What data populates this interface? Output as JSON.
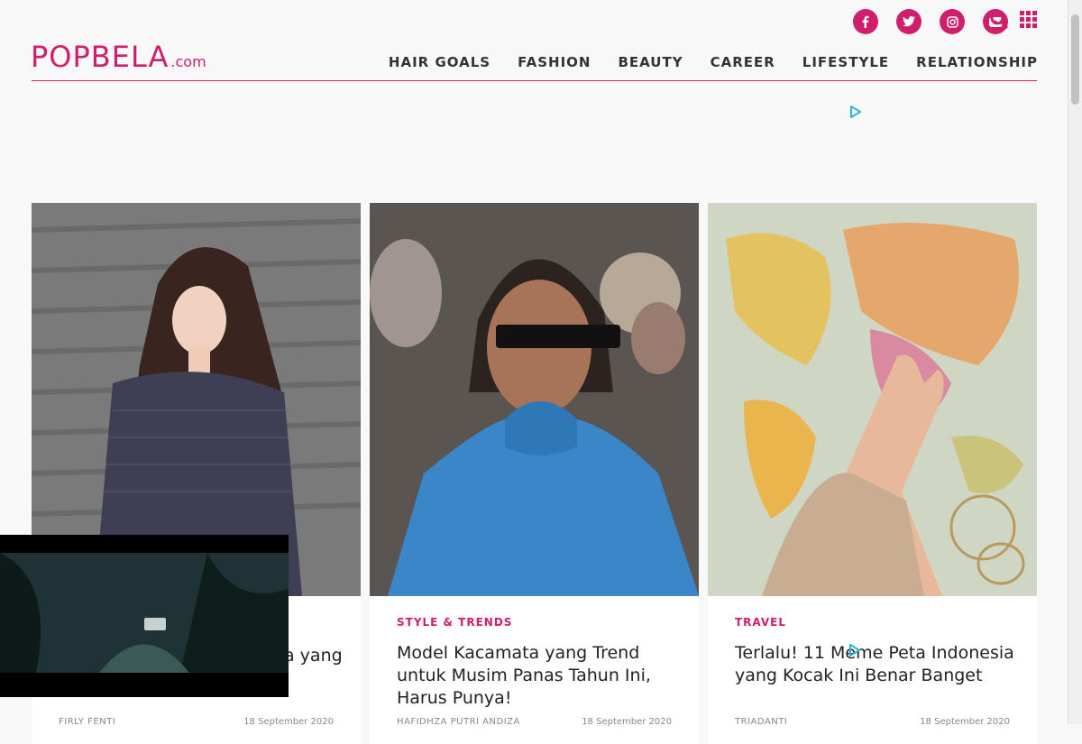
{
  "logo": {
    "main": "POPBELA",
    "suffix": ".com"
  },
  "social": [
    "f",
    "t",
    "ig",
    "yt"
  ],
  "nav": [
    "HAIR GOALS",
    "FASHION",
    "BEAUTY",
    "CAREER",
    "LIFESTYLE",
    "RELATIONSHIP"
  ],
  "colors": {
    "accent": "#cf1e6b"
  },
  "articles": [
    {
      "category": "",
      "title": "a yang",
      "author": "FIRLY FENTI",
      "date": "18 September 2020"
    },
    {
      "category": "STYLE & TRENDS",
      "title": "Model Kacamata yang Trend untuk Musim Panas Tahun Ini, Harus Punya!",
      "author": "HAFIDHZA PUTRI ANDIZA",
      "date": "18 September 2020"
    },
    {
      "category": "TRAVEL",
      "title": "Terlalu! 11 Meme Peta Indonesia yang Kocak Ini Benar Banget",
      "author": "TRIADANTI",
      "date": "18 September 2020"
    }
  ]
}
